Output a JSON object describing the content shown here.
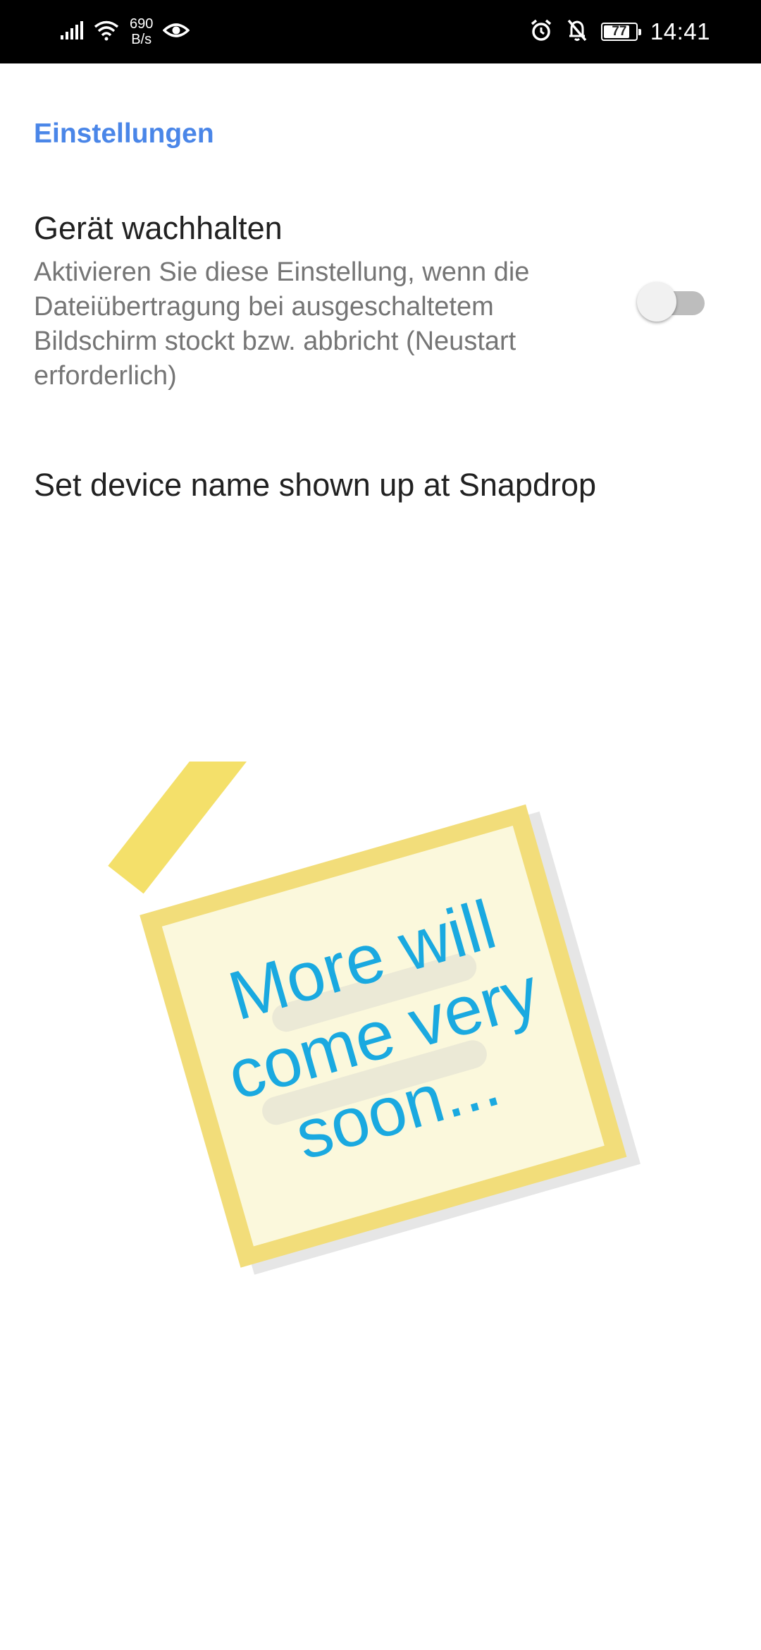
{
  "status_bar": {
    "net_speed_value": "690",
    "net_speed_unit": "B/s",
    "battery_level": "77",
    "time": "14:41",
    "icons": [
      "signal-icon",
      "wifi-icon",
      "eye-icon",
      "alarm-icon",
      "bell-off-icon",
      "battery-icon"
    ]
  },
  "settings": {
    "section_title": "Einstellungen",
    "keep_awake": {
      "title": "Gerät wachhalten",
      "summary": "Aktivieren Sie diese Einstellung, wenn die Dateiübertragung bei ausgeschaltetem Bildschirm stockt bzw. abbricht (Neustart erforderlich)",
      "enabled": false
    },
    "device_name": {
      "title": "Set device name shown up at Snapdrop"
    }
  },
  "note": {
    "line1": "More will",
    "line2": "come very",
    "line3": "soon...",
    "text_color": "#1aa9e0",
    "paper_color": "#fbf8dc",
    "border_color": "#f2dd7a",
    "tape_color": "#f2dc55"
  },
  "colors": {
    "accent": "#4a86e8",
    "status_bar": "#000000",
    "primary_text": "#212121",
    "secondary_text": "#757575"
  }
}
